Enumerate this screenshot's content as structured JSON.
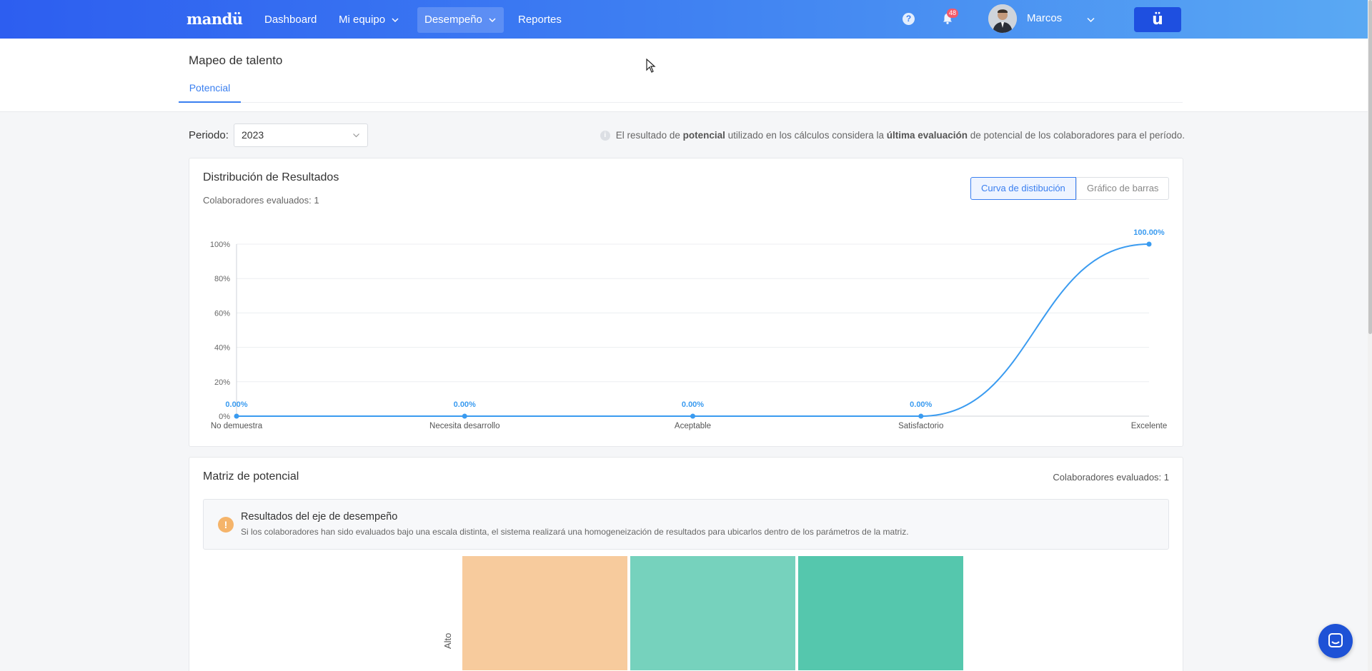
{
  "navbar": {
    "logo": "mandü",
    "items": [
      {
        "label": "Dashboard"
      },
      {
        "label": "Mi equipo"
      },
      {
        "label": "Desempeño"
      },
      {
        "label": "Reportes"
      }
    ],
    "help_label": "?",
    "notifications_count": "48",
    "user_name": "Marcos",
    "brand_button": "ü",
    "icons": [
      "help-icon",
      "bell-icon",
      "chevron-down-icon"
    ]
  },
  "header": {
    "title": "Mapeo de talento",
    "tab": "Potencial"
  },
  "period": {
    "label": "Periodo:",
    "value": "2023"
  },
  "info": {
    "t1": "El resultado de ",
    "b1": "potencial",
    "t2": " utilizado en los cálculos considera la ",
    "b2": "última evaluación",
    "t3": " de potencial de los colaboradores para el período."
  },
  "distribution": {
    "title": "Distribución de Resultados",
    "subtitle": "Colaboradores evaluados: 1",
    "toggle_curve": "Curva de distibución",
    "toggle_bars": "Gráfico de barras"
  },
  "chart_data": {
    "type": "line",
    "categories": [
      "No demuestra",
      "Necesita desarrollo",
      "Aceptable",
      "Satisfactorio",
      "Excelente"
    ],
    "values": [
      0,
      0,
      0,
      0,
      100
    ],
    "labels": [
      "0.00%",
      "0.00%",
      "0.00%",
      "0.00%",
      "100.00%"
    ],
    "yticks": [
      "0%",
      "20%",
      "40%",
      "60%",
      "80%",
      "100%"
    ],
    "ylim": [
      0,
      100
    ],
    "grid": true,
    "color": "#3a9bf0"
  },
  "matrix": {
    "title": "Matriz de potencial",
    "count": "Colaboradores evaluados: 1",
    "alert_icon": "!",
    "alert_title": "Resultados del eje de desempeño",
    "alert_text": "Si los colaboradores han sido evaluados bajo una escala distinta, el sistema realizará una homogeneización de resultados para ubicarlos dentro de los parámetros de la matriz.",
    "row_label": "Alto",
    "cells": [
      {
        "color": "#f7cb9d"
      },
      {
        "color": "#76d2bd"
      },
      {
        "color": "#55c7ad"
      }
    ]
  }
}
